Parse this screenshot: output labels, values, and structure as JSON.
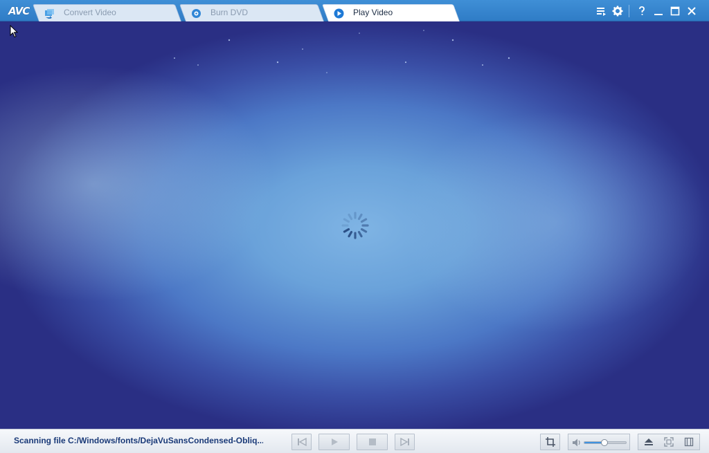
{
  "app": {
    "logo": "AVC"
  },
  "tabs": [
    {
      "label": "Convert Video",
      "icon": "convert-video-icon",
      "active": false
    },
    {
      "label": "Burn DVD",
      "icon": "disc-icon",
      "active": false
    },
    {
      "label": "Play Video",
      "icon": "play-circle-icon",
      "active": true
    }
  ],
  "window_controls": [
    "playlist-icon",
    "gear-icon",
    "help-icon",
    "minimize-icon",
    "maximize-icon",
    "close-icon"
  ],
  "status": {
    "text": "Scanning file C:/Windows/fonts/DejaVuSansCondensed-Obliq..."
  },
  "player": {
    "state": "loading",
    "volume_fraction": 0.48
  },
  "colors": {
    "titlebar": "#3388d0",
    "status_text": "#1a3a78",
    "volume_fill": "#3f92e0"
  }
}
